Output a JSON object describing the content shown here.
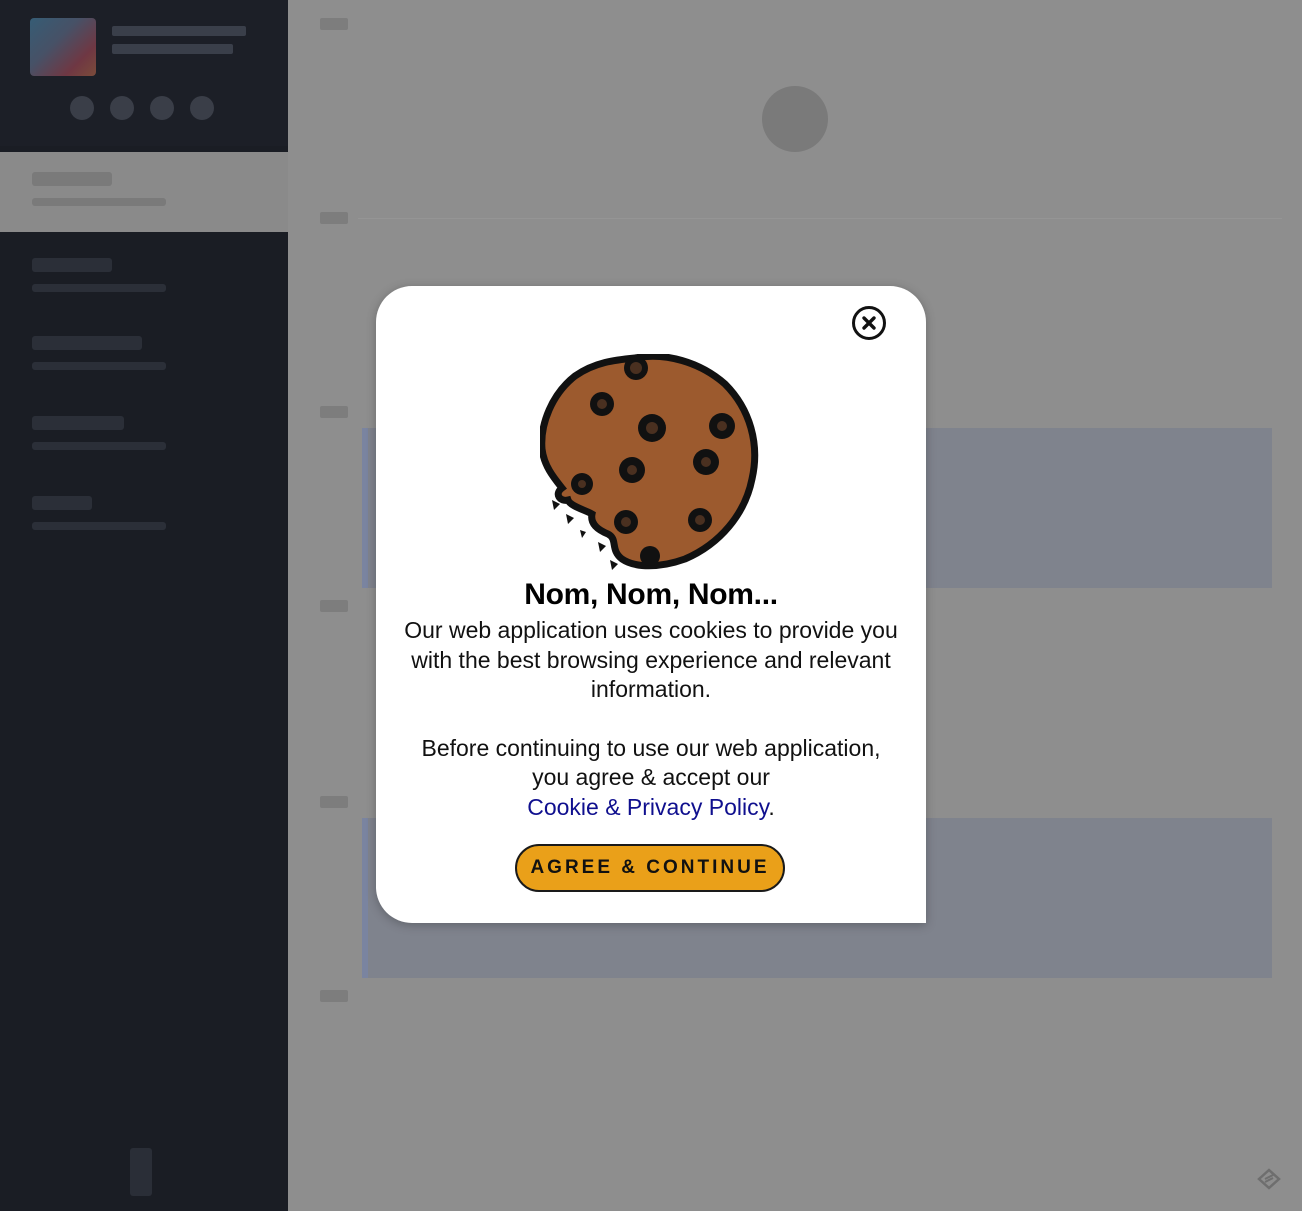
{
  "modal": {
    "title": "Nom, Nom, Nom...",
    "body_line_1": "Our web application uses cookies to provide you with the best browsing experience and relevant information.",
    "body_line_2_prefix": "Before continuing to use our web application, you agree & accept our",
    "policy_link": "Cookie & Privacy Policy",
    "body_line_2_suffix": ".",
    "agree_button": "AGREE & CONTINUE",
    "close_icon": "close-circle-icon",
    "illustration": "cookie-icon"
  },
  "colors": {
    "sidebar_bg": "#1a1d24",
    "overlay_bg": "#8e8e8e",
    "button_bg": "#eaa019",
    "link": "#0f0f8e",
    "cookie": "#9c5a2e"
  }
}
